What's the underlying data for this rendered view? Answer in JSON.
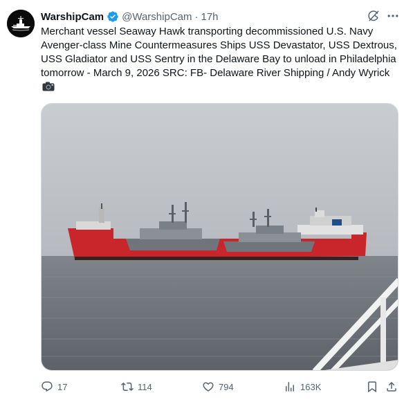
{
  "author": {
    "display_name": "WarshipCam",
    "handle": "@WarshipCam",
    "separator": "·",
    "time": "17h",
    "verified": true
  },
  "tweet": {
    "text": "Merchant vessel Seaway Hawk transporting decommissioned U.S. Navy Avenger-class Mine Countermeasures Ships USS Devastator, USS Dextrous, USS Gladiator and USS Sentry in the Delaware Bay to unload in Philadelphia tomorrow - March 9, 2026    SRC: FB- Delaware River Shipping / Andy Wyrick"
  },
  "actions": {
    "replies": "17",
    "retweets": "114",
    "likes": "794",
    "views": "163K"
  },
  "icons": {
    "verified": "verified-badge-icon",
    "grok": "grok-icon",
    "more": "more-options-icon",
    "camera": "camera-emoji-icon",
    "reply": "reply-icon",
    "retweet": "retweet-icon",
    "like": "heart-icon",
    "views": "views-icon",
    "bookmark": "bookmark-icon",
    "share": "share-icon"
  },
  "colors": {
    "text_primary": "#0f1419",
    "text_secondary": "#536471",
    "verified_blue": "#1d9bf0",
    "ship_hull_red": "#c8262a"
  }
}
